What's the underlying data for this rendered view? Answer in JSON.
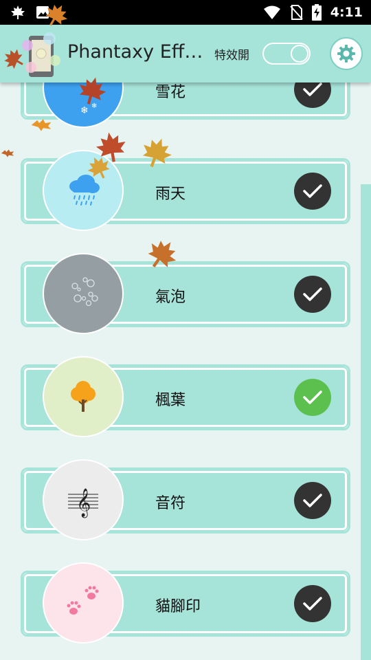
{
  "status_bar": {
    "time": "4:11",
    "left_icons": [
      "maple-leaf-icon",
      "image-icon"
    ],
    "right_icons": [
      "wifi-icon",
      "no-sim-icon",
      "battery-charging-icon"
    ]
  },
  "app_bar": {
    "title": "Phantaxy Effe...",
    "effect_toggle_label": "特效開",
    "toggle_state": "on",
    "settings_icon": "gear-icon"
  },
  "colors": {
    "accent": "#a6e3d9",
    "background": "#e8f4f2",
    "check_default": "#333333",
    "check_selected": "#5cc04f"
  },
  "effects": [
    {
      "label": "雪花",
      "icon": "snowflake-icon",
      "thumb_color": "#3ea1f0",
      "selected": false
    },
    {
      "label": "雨天",
      "icon": "rain-cloud-icon",
      "thumb_color": "#b6ecf2",
      "selected": false
    },
    {
      "label": "氣泡",
      "icon": "bubbles-icon",
      "thumb_color": "#959ea3",
      "selected": false
    },
    {
      "label": "楓葉",
      "icon": "tree-icon",
      "thumb_color": "#e1efc9",
      "selected": true
    },
    {
      "label": "音符",
      "icon": "music-note-icon",
      "thumb_color": "#ececec",
      "selected": false
    },
    {
      "label": "貓腳印",
      "icon": "paw-print-icon",
      "thumb_color": "#fde3ea",
      "selected": false
    }
  ]
}
